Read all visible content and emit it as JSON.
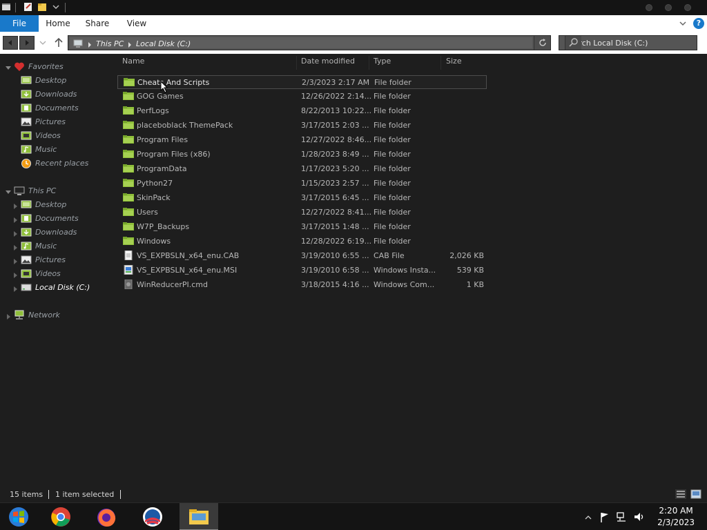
{
  "ribbon": {
    "tabs": [
      "File",
      "Home",
      "Share",
      "View"
    ]
  },
  "address": {
    "crumbs": [
      "This PC",
      "Local Disk (C:)"
    ]
  },
  "search": {
    "placeholder": "Search Local Disk (C:)"
  },
  "navpane": {
    "favorites": {
      "label": "Favorites",
      "items": [
        "Desktop",
        "Downloads",
        "Documents",
        "Pictures",
        "Videos",
        "Music",
        "Recent places"
      ]
    },
    "this_pc": {
      "label": "This PC",
      "items": [
        "Desktop",
        "Documents",
        "Downloads",
        "Music",
        "Pictures",
        "Videos",
        "Local Disk (C:)"
      ]
    },
    "network": {
      "label": "Network"
    }
  },
  "columns": {
    "name": "Name",
    "date": "Date modified",
    "type": "Type",
    "size": "Size"
  },
  "files": [
    {
      "name": "Cheats And Scripts",
      "date": "2/3/2023 2:17 AM",
      "type": "File folder",
      "size": ""
    },
    {
      "name": "GOG Games",
      "date": "12/26/2022 2:14...",
      "type": "File folder",
      "size": ""
    },
    {
      "name": "PerfLogs",
      "date": "8/22/2013 10:22...",
      "type": "File folder",
      "size": ""
    },
    {
      "name": "placeboblack ThemePack",
      "date": "3/17/2015 2:03 ...",
      "type": "File folder",
      "size": ""
    },
    {
      "name": "Program Files",
      "date": "12/27/2022 8:46...",
      "type": "File folder",
      "size": ""
    },
    {
      "name": "Program Files (x86)",
      "date": "1/28/2023 8:49 ...",
      "type": "File folder",
      "size": ""
    },
    {
      "name": "ProgramData",
      "date": "1/17/2023 5:20 ...",
      "type": "File folder",
      "size": ""
    },
    {
      "name": "Python27",
      "date": "1/15/2023 2:57 ...",
      "type": "File folder",
      "size": ""
    },
    {
      "name": "SkinPack",
      "date": "3/17/2015 6:45 ...",
      "type": "File folder",
      "size": ""
    },
    {
      "name": "Users",
      "date": "12/27/2022 8:41...",
      "type": "File folder",
      "size": ""
    },
    {
      "name": "W7P_Backups",
      "date": "3/17/2015 1:48 ...",
      "type": "File folder",
      "size": ""
    },
    {
      "name": "Windows",
      "date": "12/28/2022 6:19...",
      "type": "File folder",
      "size": ""
    },
    {
      "name": "VS_EXPBSLN_x64_enu.CAB",
      "date": "3/19/2010 6:55 ...",
      "type": "CAB File",
      "size": "2,026 KB"
    },
    {
      "name": "VS_EXPBSLN_x64_enu.MSI",
      "date": "3/19/2010 6:58 ...",
      "type": "Windows Insta...",
      "size": "539 KB"
    },
    {
      "name": "WinReducerPI.cmd",
      "date": "3/18/2015 4:16 ...",
      "type": "Windows Com...",
      "size": "1 KB"
    }
  ],
  "status": {
    "count": "15 items",
    "selected": "1 item selected"
  },
  "clock": {
    "time": "2:20 AM",
    "date": "2/3/2023"
  },
  "colors": {
    "accent": "#1979ca",
    "folder": "#8fbf3a",
    "background": "#1e1e1e"
  },
  "icons": {
    "file_types": [
      "folder-icon",
      "cab-file-icon",
      "msi-file-icon",
      "cmd-file-icon"
    ],
    "taskbar": [
      "windows-start-icon",
      "chrome-icon",
      "firefox-icon",
      "obama-logo-icon",
      "file-explorer-icon"
    ]
  }
}
